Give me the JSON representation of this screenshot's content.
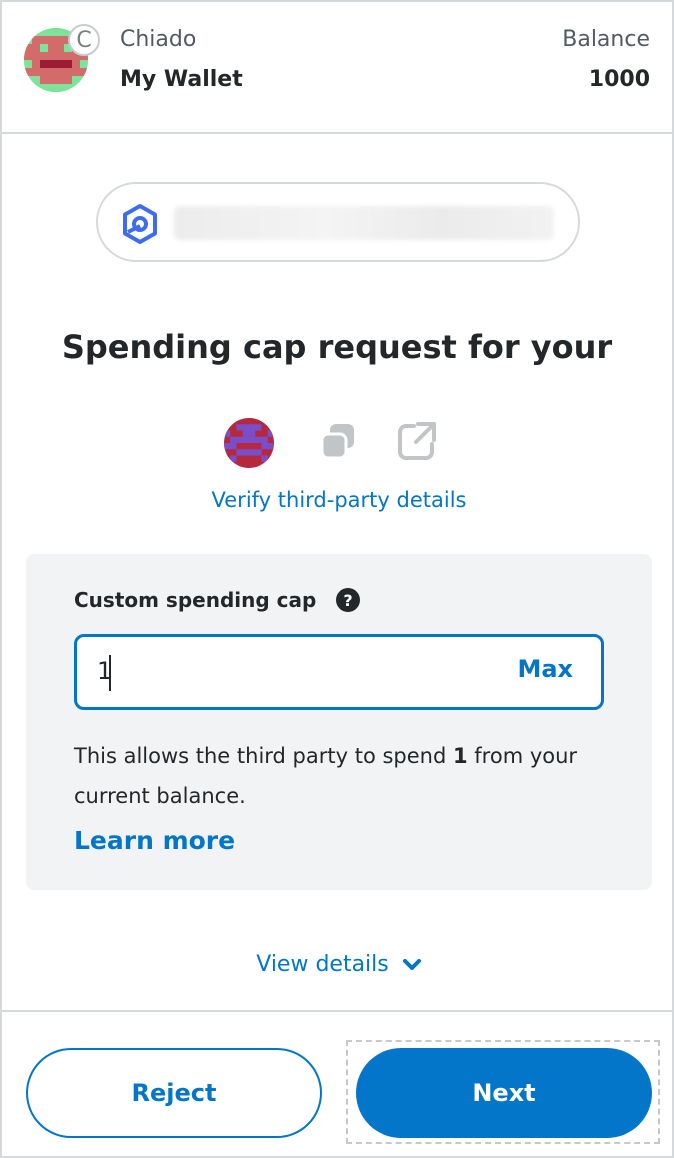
{
  "header": {
    "network_badge": "C",
    "network_name": "Chiado",
    "account_name": "My Wallet",
    "balance_label": "Balance",
    "balance_value": "1000"
  },
  "origin": {
    "icon": "dapp-site-icon"
  },
  "title": "Spending cap request for your",
  "token": {
    "avatar_icon": "token-identicon",
    "copy_icon": "copy-icon",
    "external_icon": "external-link-icon"
  },
  "verify_link": "Verify third-party details",
  "spending_cap": {
    "label": "Custom spending cap",
    "help_icon": "?",
    "value": "1",
    "max_label": "Max",
    "desc_prefix": "This allows the third party to spend ",
    "desc_amount": "1",
    "desc_suffix": " from your current balance.",
    "learn_more": "Learn more"
  },
  "view_details": "View details",
  "footer": {
    "reject_label": "Reject",
    "next_label": "Next"
  },
  "colors": {
    "primary": "#0376c9",
    "text": "#24272a",
    "border": "#d6d9dc",
    "card_bg": "#f2f3f4"
  }
}
